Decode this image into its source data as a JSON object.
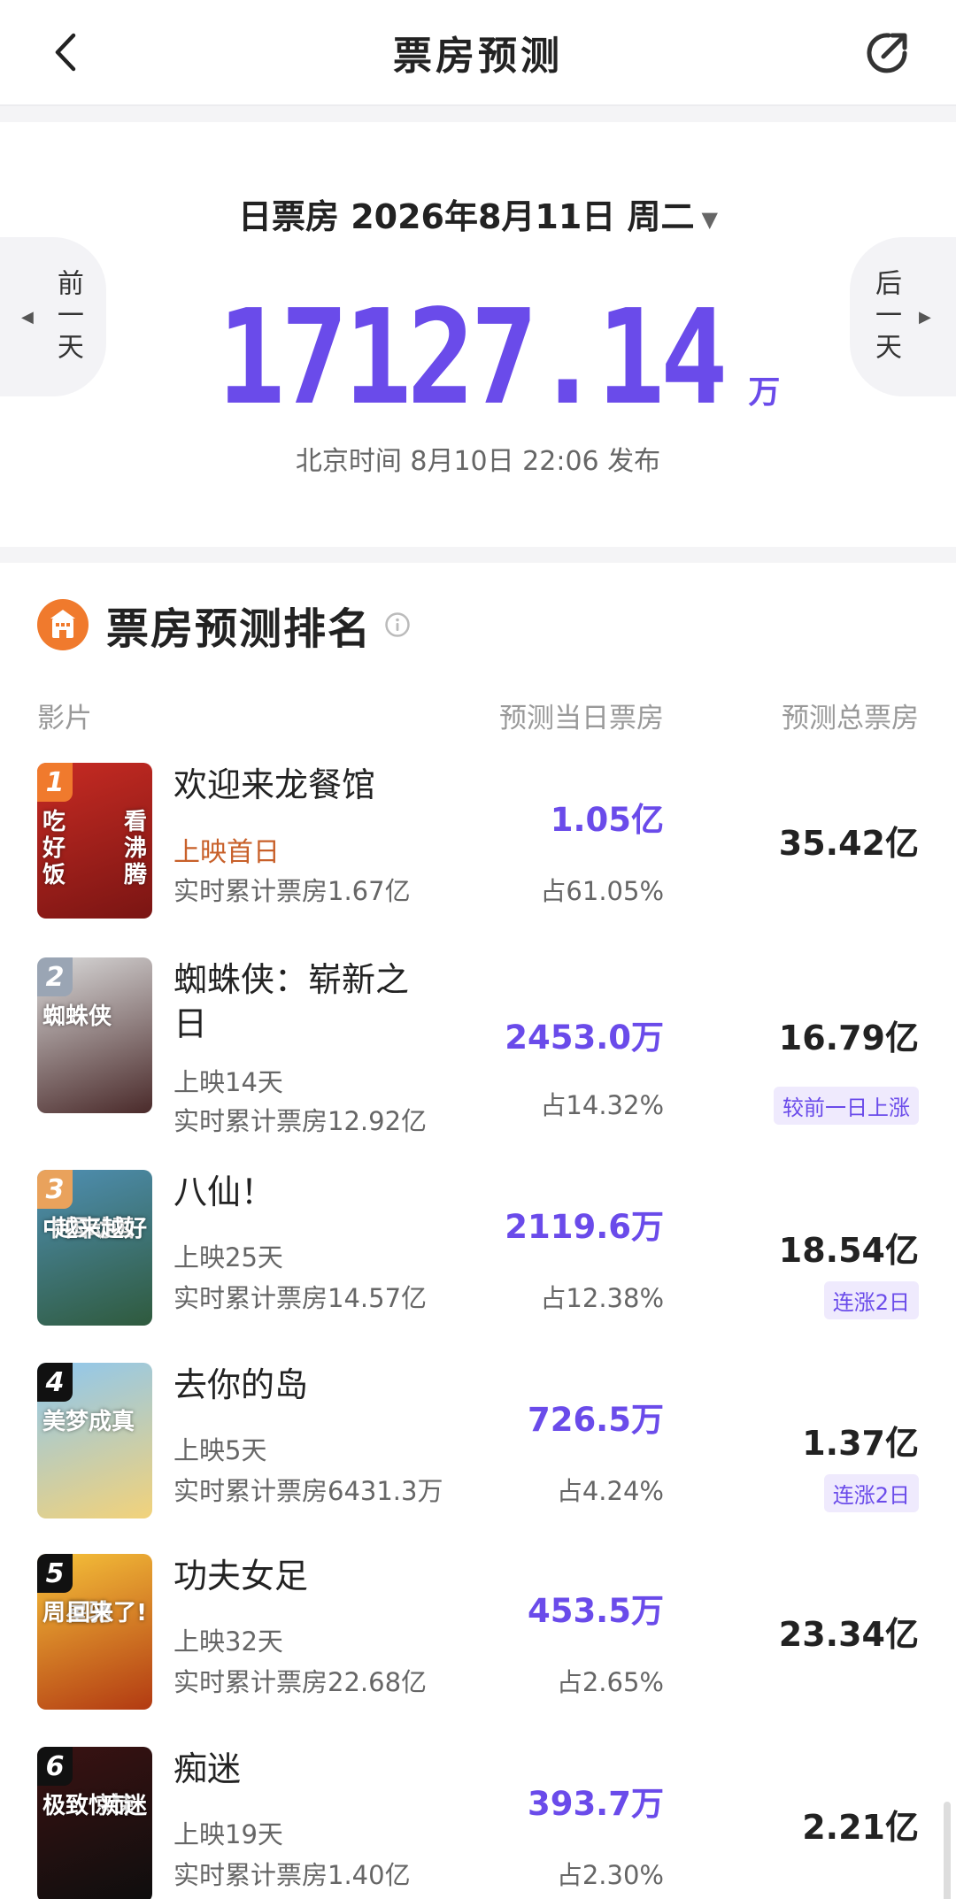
{
  "header": {
    "title": "票房预测"
  },
  "summary": {
    "date_label": "日票房 2026年8月11日 周二",
    "total_value": "17127.14",
    "total_unit": "万",
    "publish_time": "北京时间 8月10日 22:06 发布",
    "prev_day_label": "前一天",
    "next_day_label": "后一天"
  },
  "ranking": {
    "title": "票房预测排名",
    "columns": {
      "film": "影片",
      "daily": "预测当日票房",
      "total": "预测总票房"
    },
    "rows": [
      {
        "rank": "1",
        "name": "欢迎来龙餐馆",
        "status": "上映首日",
        "cumulative": "实时累计票房1.67亿",
        "daily": "1.05亿",
        "share": "占61.05%",
        "total": "35.42亿",
        "trend": "",
        "badge_color": "#f07a2d",
        "poster_colors": [
          "#c72b23",
          "#7a1513"
        ],
        "poster_text": [
          "吃",
          "好",
          "饭"
        ],
        "poster_text_right": [
          "看",
          "沸",
          "腾"
        ]
      },
      {
        "rank": "2",
        "name": "蜘蛛侠：崭新之日",
        "status": "上映14天",
        "cumulative": "实时累计票房12.92亿",
        "daily": "2453.0万",
        "share": "占14.32%",
        "total": "16.79亿",
        "trend": "较前一日上涨",
        "badge_color": "#9aa5b4",
        "poster_colors": [
          "#d9d9d9",
          "#4a2a2a"
        ],
        "poster_text": [
          "蜘蛛侠"
        ],
        "poster_text_right": []
      },
      {
        "rank": "3",
        "name": "八仙！",
        "status": "上映25天",
        "cumulative": "实时累计票房14.57亿",
        "daily": "2119.6万",
        "share": "占12.38%",
        "total": "18.54亿",
        "trend": "连涨2日",
        "badge_color": "#e9a25c",
        "poster_colors": [
          "#4f8fb3",
          "#2f5a3d"
        ],
        "poster_text": [
          "中国动画"
        ],
        "poster_text_right": [
          "越来越好"
        ]
      },
      {
        "rank": "4",
        "name": "去你的岛",
        "status": "上映5天",
        "cumulative": "实时累计票房6431.3万",
        "daily": "726.5万",
        "share": "占4.24%",
        "total": "1.37亿",
        "trend": "连涨2日",
        "badge_color": "#111111",
        "poster_colors": [
          "#8ec7ef",
          "#f2d27a"
        ],
        "poster_text": [
          "美梦成真"
        ],
        "poster_text_right": []
      },
      {
        "rank": "5",
        "name": "功夫女足",
        "status": "上映32天",
        "cumulative": "实时累计票房22.68亿",
        "daily": "453.5万",
        "share": "占2.65%",
        "total": "23.34亿",
        "trend": "",
        "badge_color": "#111111",
        "poster_colors": [
          "#f6c23a",
          "#b23a12"
        ],
        "poster_text": [
          "周星驰"
        ],
        "poster_text_right": [
          "回来了!"
        ]
      },
      {
        "rank": "6",
        "name": "痴迷",
        "status": "上映19天",
        "cumulative": "实时累计票房1.40亿",
        "daily": "393.7万",
        "share": "占2.30%",
        "total": "2.21亿",
        "trend": "",
        "badge_color": "#111111",
        "poster_colors": [
          "#3a1212",
          "#0e0e0e"
        ],
        "poster_text": [
          "极致惊悚"
        ],
        "poster_text_right": [
          "痴迷"
        ]
      }
    ]
  }
}
